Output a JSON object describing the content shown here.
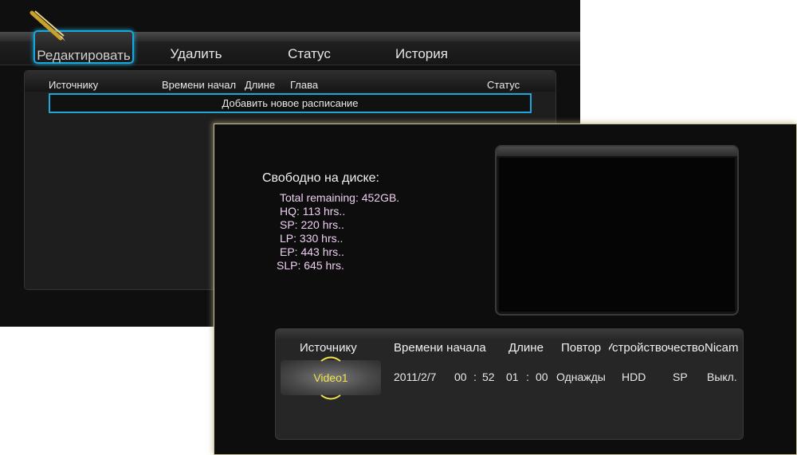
{
  "back_screen": {
    "tabs": [
      {
        "label": "Редактировать",
        "active": true
      },
      {
        "label": "Удалить",
        "active": false
      },
      {
        "label": "Статус",
        "active": false
      },
      {
        "label": "История",
        "active": false
      }
    ],
    "table": {
      "columns": [
        "Источнику",
        "Времени начал",
        "Длине",
        "Глава",
        "Статус"
      ],
      "row": "Добавить новое расписание"
    },
    "icons": [
      "pencil-icon"
    ],
    "colors": {
      "accent": "#1fa6d9"
    }
  },
  "front_screen": {
    "disk": {
      "title": "Свободно на диске:",
      "lines": [
        "Total remaining: 452GB.",
        "HQ: 113 hrs..",
        "SP: 220 hrs..",
        "LP: 330 hrs..",
        "EP: 443 hrs..",
        "SLP: 645 hrs."
      ]
    },
    "schedule": {
      "columns": [
        "Источнику",
        "Времени начала",
        "Длине",
        "Повтор",
        "Устройство",
        "Качество",
        "Nicam"
      ],
      "row": {
        "source": "Video1",
        "date": "2011/2/7",
        "start_hh": "00",
        "start_sep": ":",
        "start_mm": "52",
        "len_hh": "01",
        "len_sep": ":",
        "len_mm": "00",
        "repeat": "Однажды",
        "device": "HDD",
        "quality": "SP",
        "nicam": "Выкл."
      }
    },
    "colors": {
      "selected_text": "#f0e34a",
      "disk_lines": "#eecff2"
    }
  }
}
